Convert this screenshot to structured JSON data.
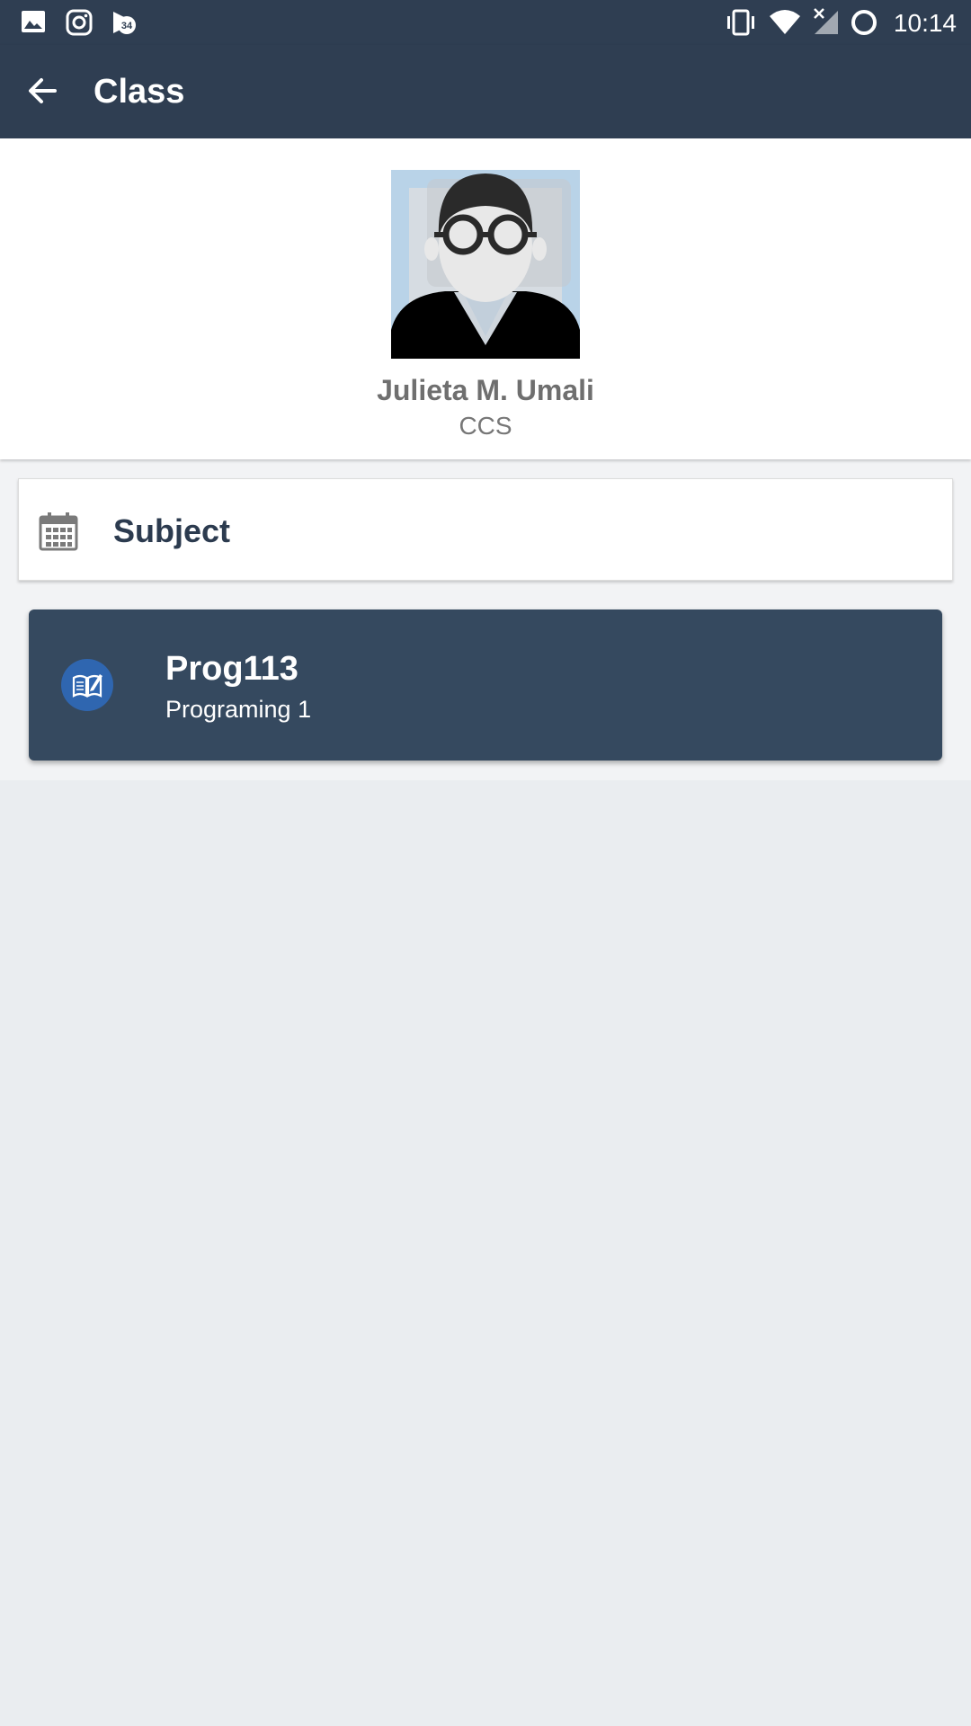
{
  "status_bar": {
    "time": "10:14",
    "left_icons": [
      "image-icon",
      "instagram-icon",
      "notification-badge-icon"
    ],
    "badge_count": "34",
    "right_icons": [
      "vibrate-icon",
      "wifi-icon",
      "signal-off-icon",
      "sync-icon"
    ]
  },
  "app_bar": {
    "title": "Class",
    "back_icon": "arrow-left-icon"
  },
  "profile": {
    "name": "Julieta M. Umali",
    "department": "CCS",
    "avatar_icon": "avatar-glasses-icon"
  },
  "subject_section": {
    "label": "Subject",
    "icon": "calendar-icon"
  },
  "subjects": [
    {
      "code": "Prog113",
      "name": "Programing 1",
      "icon": "book-edit-icon"
    }
  ],
  "colors": {
    "primary_dark": "#2f3e52",
    "card_dark": "#35495f",
    "icon_blue": "#2f66b0",
    "background": "#eaedf0"
  }
}
